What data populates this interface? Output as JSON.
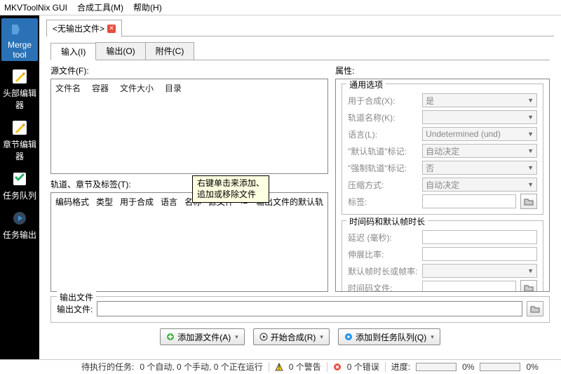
{
  "menu": {
    "app": "MKVToolNix GUI",
    "merge": "合成工具(M)",
    "help": "帮助(H)"
  },
  "sidebar": {
    "items": [
      {
        "label": "Merge tool"
      },
      {
        "label": "头部编辑器"
      },
      {
        "label": "章节编辑器"
      },
      {
        "label": "任务队列"
      },
      {
        "label": "任务输出"
      }
    ]
  },
  "doc_tab": {
    "title": "<无输出文件>"
  },
  "tabs": {
    "input": "输入(I)",
    "output": "输出(O)",
    "attach": "附件(C)"
  },
  "source": {
    "label": "源文件(F):",
    "cols": {
      "name": "文件名",
      "container": "容器",
      "size": "文件大小",
      "dir": "目录"
    }
  },
  "tracks": {
    "label": "轨道、章节及标签(T):",
    "cols": {
      "codec": "编码格式",
      "type": "类型",
      "mux": "用于合成",
      "lang": "语言",
      "name": "名称",
      "src": "源文件",
      "id": "ID",
      "defdur": "输出文件的默认轨"
    }
  },
  "tooltip": {
    "line1": "右键单击来添加、",
    "line2": "追加或移除文件"
  },
  "props": {
    "label": "属性:",
    "general": {
      "title": "通用选项",
      "mux": {
        "label": "用于合成(X):",
        "value": "是"
      },
      "trackname": {
        "label": "轨道名称(K):"
      },
      "language": {
        "label": "语言(L):",
        "value": "Undetermined (und)"
      },
      "defaultflag": {
        "label": "\"默认轨道\"标记:",
        "value": "自动决定"
      },
      "forcedflag": {
        "label": "\"强制轨道\"标记:",
        "value": "否"
      },
      "compression": {
        "label": "压缩方式:",
        "value": "自动决定"
      },
      "tags": {
        "label": "标签:"
      }
    },
    "timing": {
      "title": "时间码和默认帧时长",
      "delay": {
        "label": "延迟 (毫秒):"
      },
      "stretch": {
        "label": "伸展比率:"
      },
      "defaultdur": {
        "label": "默认帧时长或帧率:"
      },
      "timecode": {
        "label": "时间码文件:"
      }
    }
  },
  "output": {
    "group": "输出文件",
    "label": "输出文件:"
  },
  "buttons": {
    "addsrc": "添加源文件(A)",
    "start": "开始合成(R)",
    "queue": "添加到任务队列(Q)"
  },
  "status": {
    "pending_label": "待执行的任务:",
    "pending_value": "0 个自动, 0 个手动, 0 个正在运行",
    "warnings": "0 个警告",
    "errors": "0 个错误",
    "progress": "进度:",
    "pct": "0%"
  }
}
